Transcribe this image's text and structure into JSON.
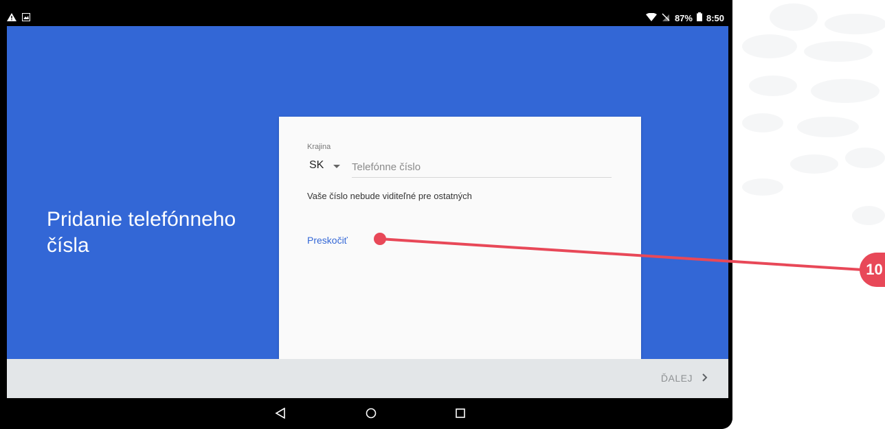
{
  "status_bar": {
    "battery_text": "87%",
    "time": "8:50"
  },
  "setup": {
    "title": "Pridanie telefónneho čísla",
    "country_label": "Krajina",
    "country_value": "SK",
    "phone_placeholder": "Telefónne číslo",
    "hint_text": "Vaše číslo nebude viditeľné pre ostatných",
    "skip_label": "Preskočiť",
    "next_label": "ĎALEJ"
  },
  "annotation": {
    "step_number": "10",
    "color": "#e84858"
  },
  "colors": {
    "primary_blue": "#3367d6",
    "footer_gray": "#e3e6e8"
  }
}
